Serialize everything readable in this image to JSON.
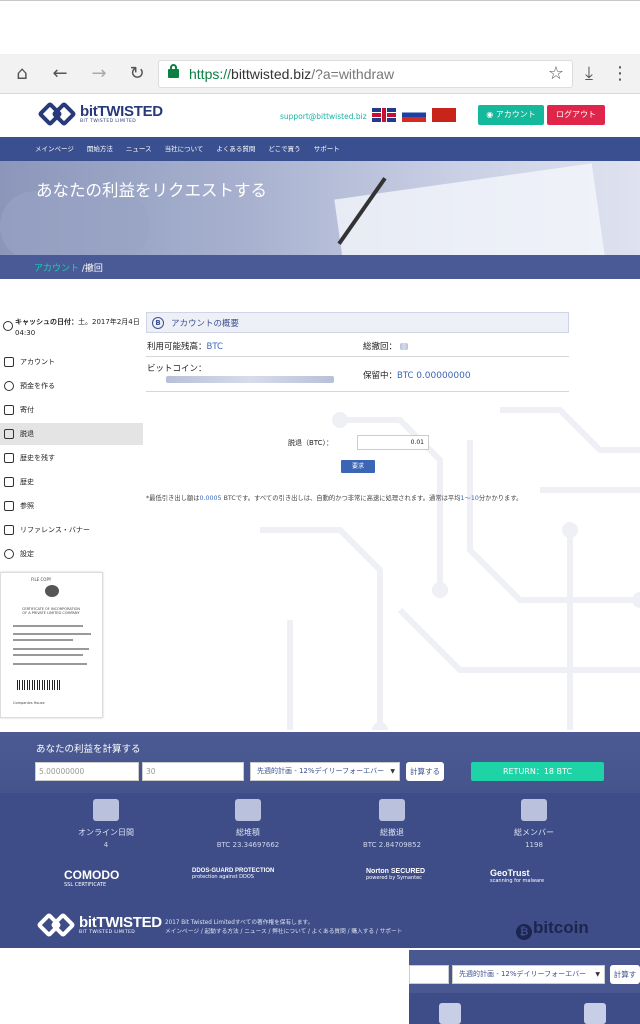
{
  "browser": {
    "url_scheme": "https://",
    "url_domain": "bittwisted.biz",
    "url_path": "/?a=withdraw"
  },
  "header": {
    "logo_main": "bitTWISTED",
    "logo_sub": "BIT TWISTED LIMITED",
    "support_email": "support@bittwisted.biz",
    "account_label": "アカウント",
    "logout_label": "ログアウト"
  },
  "nav": {
    "items": [
      "メインページ",
      "開始方法",
      "ニュース",
      "当社について",
      "よくある質問",
      "どこで買う",
      "サポート"
    ]
  },
  "hero": {
    "title": "あなたの利益をリクエストする",
    "crumb_link": "アカウント",
    "crumb_current": " /撤回"
  },
  "sidebar": {
    "cash_date_label": "キャッシュの日付：",
    "cash_date_value": "土。2017年2月4日04:30",
    "items": [
      "アカウント",
      "預金を作る",
      "寄付",
      "脱退",
      "歴史を残す",
      "歴史",
      "参照",
      "リファレンス・バナー",
      "設定"
    ],
    "certificate": {
      "header": "FILE COPY",
      "title": "CERTIFICATE OF INCORPORATION OF A PRIVATE LIMITED COMPANY",
      "footer": "Companies House"
    }
  },
  "account": {
    "section_title": "アカウントの概要",
    "available_label": "利用可能残高：",
    "available_value": "BTC",
    "total_withdrawn_label": "総撤回：",
    "bitcoin_label": "ビットコイン：",
    "pending_label": "保留中：",
    "pending_currency": "BTC",
    "pending_amount": "0.00000000"
  },
  "withdraw_form": {
    "label": "脱退（BTC）：",
    "amount": "0.01",
    "submit_label": "要求",
    "note_prefix": "*最低引き出し額は",
    "note_min": "0.0005",
    "note_middle": " BTCです。すべての引き出しは、自動的かつ非常に高速に処理されます。通常は平均",
    "note_range": "1～10",
    "note_suffix": "分かかります。"
  },
  "calculator": {
    "title": "あなたの利益を計算する",
    "amount": "5.00000000",
    "days": "30",
    "plan": "先週的計画 - 12%デイリーフォーエバー",
    "calc_label": "計算する",
    "return_label": "RETURN：18 BTC"
  },
  "stats": [
    {
      "label": "オンライン日間",
      "value": "4"
    },
    {
      "label": "総堆積",
      "value": "BTC 23.34697662"
    },
    {
      "label": "総撤退",
      "value": "BTC 2.84709852"
    },
    {
      "label": "総メンバー",
      "value": "1198"
    }
  ],
  "badges": {
    "comodo": "COMODO",
    "comodo_sub": "SSL CERTIFICATE",
    "ddos": "DDOS-GUARD PROTECTION",
    "ddos_sub": "protection against DDOS",
    "norton": "Norton SECURED",
    "norton_sub": "powered by Symantec",
    "geotrust": "GeoTrust",
    "geotrust_sub": "scanning for malware"
  },
  "footer": {
    "copyright": "2017 Bit Twisted Limitedすべての著作権を保有します。",
    "links": "メインページ / 起動する方法 / ニュース / 弊社について / よくある質問 / 購入する / サポート",
    "bitcoin": "bitcoin"
  },
  "fragment": {
    "plan": "先週的計画 - 12%デイリーフォーエバー",
    "calc_label": "計算す"
  }
}
